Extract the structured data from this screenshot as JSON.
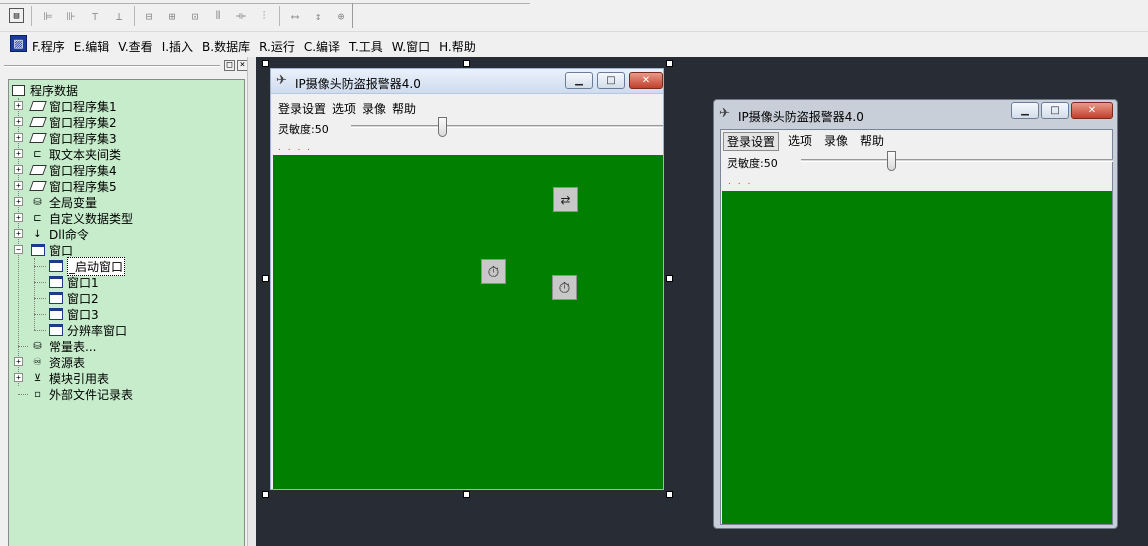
{
  "menubar": {
    "items": [
      "F.程序",
      "E.编辑",
      "V.查看",
      "I.插入",
      "B.数据库",
      "R.运行",
      "C.编译",
      "T.工具",
      "W.窗口",
      "H.帮助"
    ]
  },
  "tree": {
    "root": "程序数据",
    "nodes": [
      "窗口程序集1",
      "窗口程序集2",
      "窗口程序集3",
      "取文本夹间类",
      "窗口程序集4",
      "窗口程序集5",
      "全局变量",
      "自定义数据类型",
      "Dll命令",
      "窗口"
    ],
    "windows": [
      "_启动窗口",
      "窗口1",
      "窗口2",
      "窗口3",
      "分辨率窗口"
    ],
    "tail": [
      "常量表...",
      "资源表",
      "模块引用表",
      "外部文件记录表"
    ],
    "panel_buttons": [
      "□",
      "×"
    ]
  },
  "design_form": {
    "title": "IP摄像头防盗报警器4.0",
    "menu": [
      "登录设置",
      "选项",
      "录像",
      "帮助"
    ],
    "sensitivity": "灵敏度:50",
    "dots": ". . . ."
  },
  "preview_form": {
    "title": "IP摄像头防盗报警器4.0",
    "menu": [
      "登录设置",
      "选项",
      "录像",
      "帮助"
    ],
    "sensitivity": "灵敏度:50",
    "dots": ". . ."
  },
  "colors": {
    "tree_background": "#c6eccb",
    "design_background": "#282c34",
    "form_green": "#007f00"
  }
}
